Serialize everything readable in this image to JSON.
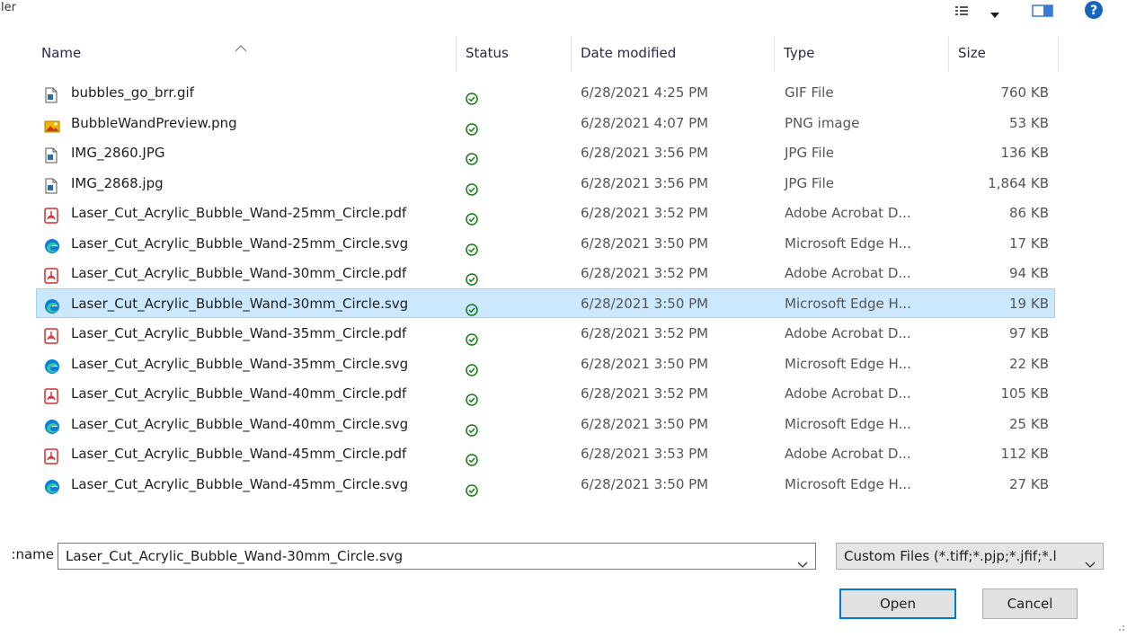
{
  "window": {
    "title_fragment": "ler",
    "view_icons": [
      "details-view-icon",
      "view-dropdown-chevron-icon",
      "preview-pane-icon",
      "help-icon"
    ]
  },
  "columns": {
    "name": "Name",
    "status": "Status",
    "date_modified": "Date modified",
    "type": "Type",
    "size": "Size",
    "sort_indicator": "up"
  },
  "files": [
    {
      "name": "bubbles_go_brr.gif",
      "icon": "image-file-icon",
      "status": "sync-available-icon",
      "date": "6/28/2021 4:25 PM",
      "type": "GIF File",
      "size": "760 KB"
    },
    {
      "name": "BubbleWandPreview.png",
      "icon": "png-image-icon",
      "status": "sync-available-icon",
      "date": "6/28/2021 4:07 PM",
      "type": "PNG image",
      "size": "53 KB"
    },
    {
      "name": "IMG_2860.JPG",
      "icon": "image-file-icon",
      "status": "sync-available-icon",
      "date": "6/28/2021 3:56 PM",
      "type": "JPG File",
      "size": "136 KB"
    },
    {
      "name": "IMG_2868.jpg",
      "icon": "image-file-icon",
      "status": "sync-available-icon",
      "date": "6/28/2021 3:56 PM",
      "type": "JPG File",
      "size": "1,864 KB"
    },
    {
      "name": "Laser_Cut_Acrylic_Bubble_Wand-25mm_Circle.pdf",
      "icon": "pdf-file-icon",
      "status": "sync-available-icon",
      "date": "6/28/2021 3:52 PM",
      "type": "Adobe Acrobat D...",
      "size": "86 KB"
    },
    {
      "name": "Laser_Cut_Acrylic_Bubble_Wand-25mm_Circle.svg",
      "icon": "edge-file-icon",
      "status": "sync-available-icon",
      "date": "6/28/2021 3:50 PM",
      "type": "Microsoft Edge H...",
      "size": "17 KB"
    },
    {
      "name": "Laser_Cut_Acrylic_Bubble_Wand-30mm_Circle.pdf",
      "icon": "pdf-file-icon",
      "status": "sync-available-icon",
      "date": "6/28/2021 3:52 PM",
      "type": "Adobe Acrobat D...",
      "size": "94 KB"
    },
    {
      "name": "Laser_Cut_Acrylic_Bubble_Wand-30mm_Circle.svg",
      "icon": "edge-file-icon",
      "status": "sync-available-icon",
      "date": "6/28/2021 3:50 PM",
      "type": "Microsoft Edge H...",
      "size": "19 KB",
      "selected": true
    },
    {
      "name": "Laser_Cut_Acrylic_Bubble_Wand-35mm_Circle.pdf",
      "icon": "pdf-file-icon",
      "status": "sync-available-icon",
      "date": "6/28/2021 3:52 PM",
      "type": "Adobe Acrobat D...",
      "size": "97 KB"
    },
    {
      "name": "Laser_Cut_Acrylic_Bubble_Wand-35mm_Circle.svg",
      "icon": "edge-file-icon",
      "status": "sync-available-icon",
      "date": "6/28/2021 3:50 PM",
      "type": "Microsoft Edge H...",
      "size": "22 KB"
    },
    {
      "name": "Laser_Cut_Acrylic_Bubble_Wand-40mm_Circle.pdf",
      "icon": "pdf-file-icon",
      "status": "sync-available-icon",
      "date": "6/28/2021 3:52 PM",
      "type": "Adobe Acrobat D...",
      "size": "105 KB"
    },
    {
      "name": "Laser_Cut_Acrylic_Bubble_Wand-40mm_Circle.svg",
      "icon": "edge-file-icon",
      "status": "sync-available-icon",
      "date": "6/28/2021 3:50 PM",
      "type": "Microsoft Edge H...",
      "size": "25 KB"
    },
    {
      "name": "Laser_Cut_Acrylic_Bubble_Wand-45mm_Circle.pdf",
      "icon": "pdf-file-icon",
      "status": "sync-available-icon",
      "date": "6/28/2021 3:53 PM",
      "type": "Adobe Acrobat D...",
      "size": "112 KB"
    },
    {
      "name": "Laser_Cut_Acrylic_Bubble_Wand-45mm_Circle.svg",
      "icon": "edge-file-icon",
      "status": "sync-available-icon",
      "date": "6/28/2021 3:50 PM",
      "type": "Microsoft Edge H...",
      "size": "27 KB"
    }
  ],
  "filename": {
    "label_fragment": "name:",
    "value": "Laser_Cut_Acrylic_Bubble_Wand-30mm_Circle.svg"
  },
  "filter": {
    "selected": "Custom Files (*.tiff;*.pjp;*.jfif;*.l"
  },
  "buttons": {
    "open": "Open",
    "cancel": "Cancel"
  },
  "colors": {
    "selection_bg": "#cce8ff",
    "selection_border": "#99d1ff",
    "status_green": "#107c10",
    "pdf_red": "#d32f2f",
    "edge_blue": "#0a7fd8",
    "accent": "#0078d7"
  }
}
